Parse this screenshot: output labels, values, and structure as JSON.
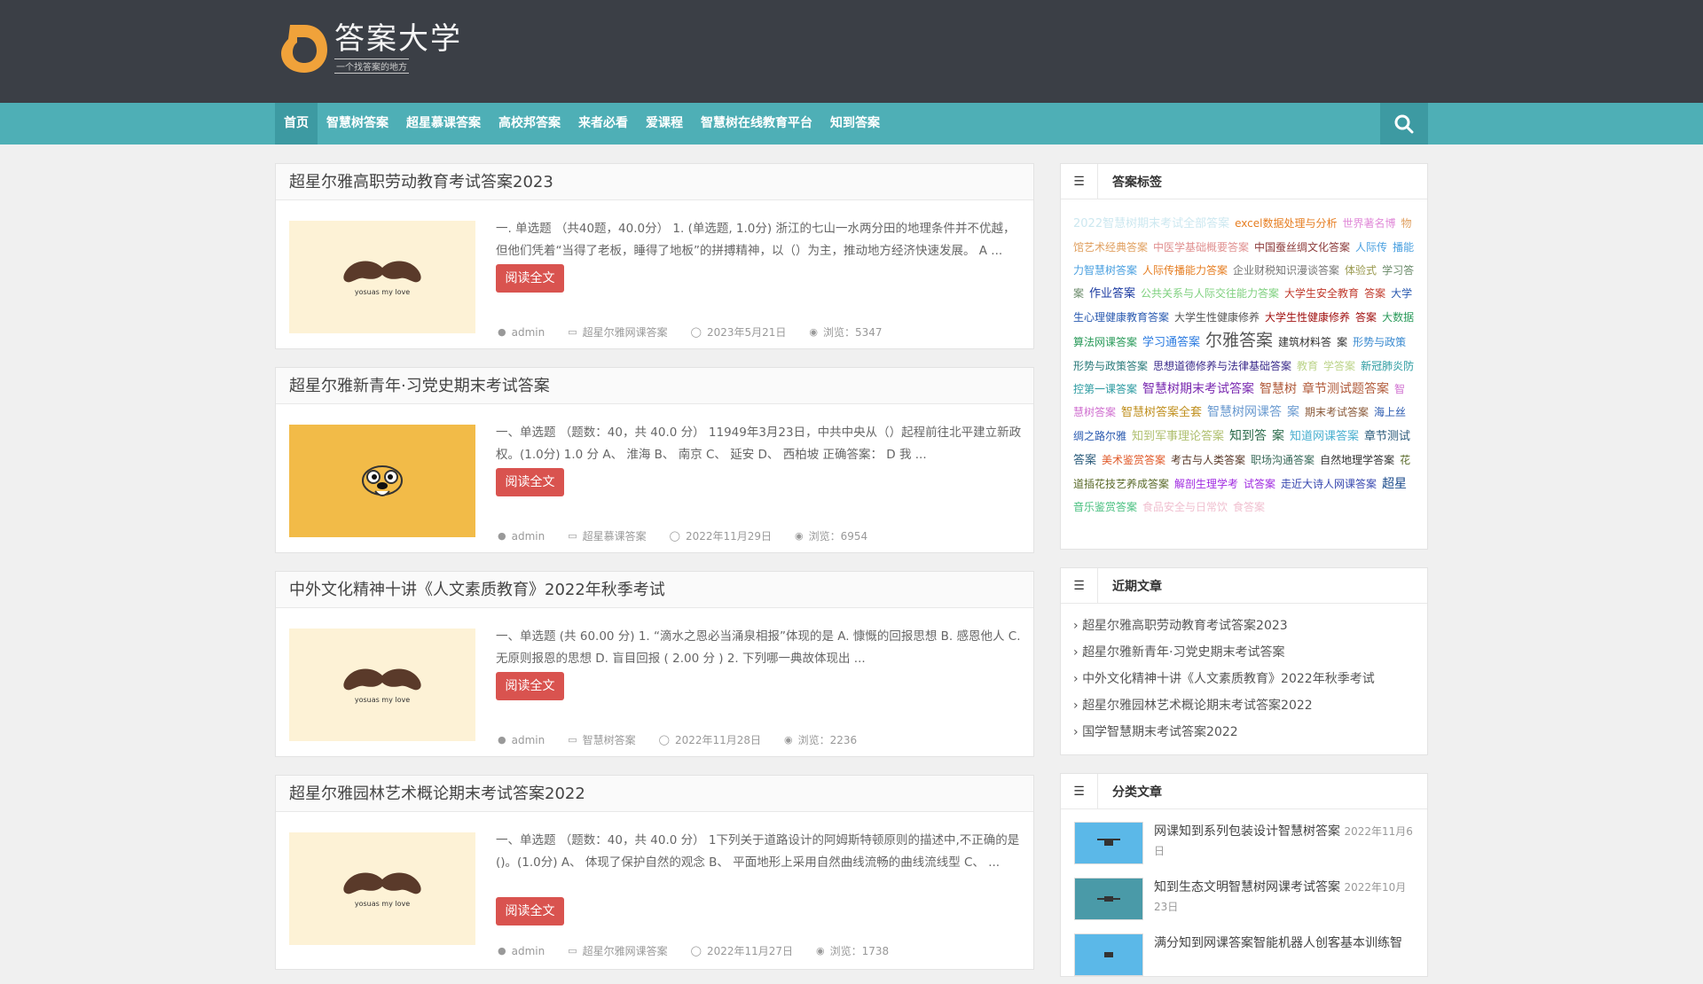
{
  "site": {
    "logo_title": "答案大学",
    "logo_sub": "一个找答案的地方"
  },
  "nav": {
    "items": [
      {
        "label": "首页"
      },
      {
        "label": "智慧树答案"
      },
      {
        "label": "超星慕课答案"
      },
      {
        "label": "高校邦答案"
      },
      {
        "label": "来者必看"
      },
      {
        "label": "爱课程"
      },
      {
        "label": "智慧树在线教育平台"
      },
      {
        "label": "知到答案"
      }
    ],
    "search_icon": "search-icon"
  },
  "articles": [
    {
      "title": "超星尔雅高职劳动教育考试答案2023",
      "excerpt": "一. 单选题 （共40题，40.0分） 1. (单选题, 1.0分) 浙江的七山一水两分田的地理条件并不优越，但他们凭着“当得了老板，睡得了地板”的拼搏精神，以（）为主，推动地方经济快速发展。 A ...",
      "read_label": "阅读全文",
      "author": "admin",
      "category": "超星尔雅网课答案",
      "date": "2023年5月21日",
      "views": "浏览：5347",
      "thumb": "mustache"
    },
    {
      "title": "超星尔雅新青年·习党史期末考试答案",
      "excerpt": "一、单选题 （题数：40，共 40.0 分） 11949年3月23日，中共中央从（）起程前往北平建立新政权。(1.0分) 1.0 分 A、 淮海 B、 南京 C、 延安 D、 西柏坡 正确答案： D 我 ...",
      "read_label": "阅读全文",
      "author": "admin",
      "category": "超星慕课答案",
      "date": "2022年11月29日",
      "views": "浏览：6954",
      "thumb": "dog"
    },
    {
      "title": "中外文化精神十讲《人文素质教育》2022年秋季考试",
      "excerpt": "一、单选题 (共 60.00 分) 1. “滴水之恩必当涌泉相报”体现的是 A. 慷慨的回报思想 B. 感恩他人 C. 无原则报恩的思想 D. 盲目回报 ( 2.00 分 ) 2. 下列哪一典故体现出 ...",
      "read_label": "阅读全文",
      "author": "admin",
      "category": "智慧树答案",
      "date": "2022年11月28日",
      "views": "浏览：2236",
      "thumb": "mustache"
    },
    {
      "title": "超星尔雅园林艺术概论期末考试答案2022",
      "excerpt": "一、单选题 （题数：40，共 40.0 分） 1下列关于道路设计的阿姆斯特顿原则的描述中,不正确的是()。(1.0分) A、 体现了保护自然的观念 B、 平面地形上采用自然曲线流畅的曲线流线型 C、 ...",
      "read_label": "阅读全文",
      "author": "admin",
      "category": "超星尔雅网课答案",
      "date": "2022年11月27日",
      "views": "浏览：1738",
      "thumb": "mustache"
    }
  ],
  "tags_widget": {
    "title": "答案标签",
    "tags": [
      {
        "text": "2022智慧树期末考试全部答案",
        "color": "#cde8f0",
        "size": 13
      },
      {
        "text": "excel数据处理与分析",
        "color": "#e67e22",
        "size": 12
      },
      {
        "text": "世界著名博",
        "color": "#e08ad8",
        "size": 12
      },
      {
        "text": "物馆艺术经典答案",
        "color": "#e0a060",
        "size": 12
      },
      {
        "text": "中医学基础概要答案",
        "color": "#e09090",
        "size": 12
      },
      {
        "text": "中国蚕丝绸文化答案",
        "color": "#8b3a3a",
        "size": 12
      },
      {
        "text": "人际传",
        "color": "#4aa0e0",
        "size": 12
      },
      {
        "text": "播能力智慧树答案",
        "color": "#4aa0e0",
        "size": 12
      },
      {
        "text": "人际传播能力答案",
        "color": "#e67e22",
        "size": 12
      },
      {
        "text": "企业财税知识漫谈答案",
        "color": "#777",
        "size": 12
      },
      {
        "text": "体验式",
        "color": "#9a9a50",
        "size": 12
      },
      {
        "text": "学习答案",
        "color": "#6a8a6a",
        "size": 12
      },
      {
        "text": "作业答案",
        "color": "#1a3aa0",
        "size": 13
      },
      {
        "text": "公共关系与人际交往能力答案",
        "color": "#7ed07e",
        "size": 12
      },
      {
        "text": "大学生安全教育",
        "color": "#c0392b",
        "size": 12
      },
      {
        "text": "答案",
        "color": "#c0392b",
        "size": 12
      },
      {
        "text": "大学生心理健康教育答案",
        "color": "#2a5ab0",
        "size": 12
      },
      {
        "text": "大学生性健康修养",
        "color": "#555",
        "size": 12
      },
      {
        "text": "大学生性健康修养",
        "color": "#a01010",
        "size": 12
      },
      {
        "text": "答案",
        "color": "#a01010",
        "size": 12
      },
      {
        "text": "大数据算法网课答案",
        "color": "#2a9a5a",
        "size": 12
      },
      {
        "text": "学习通答案",
        "color": "#2a7ae0",
        "size": 13
      },
      {
        "text": "尔雅答案",
        "color": "#555",
        "size": 19
      },
      {
        "text": "建筑材料答",
        "color": "#333",
        "size": 12
      },
      {
        "text": "案",
        "color": "#333",
        "size": 12
      },
      {
        "text": "形势与政策",
        "color": "#3a8ad0",
        "size": 12
      },
      {
        "text": "形势与政策答案",
        "color": "#2a7a7a",
        "size": 12
      },
      {
        "text": "思想道德修养与法律基础答案",
        "color": "#3a2a8a",
        "size": 12
      },
      {
        "text": "教育",
        "color": "#bcd48a",
        "size": 12
      },
      {
        "text": "学答案",
        "color": "#bcd48a",
        "size": 12
      },
      {
        "text": "新冠肺炎防控第一课答案",
        "color": "#2a9aa0",
        "size": 12
      },
      {
        "text": "智慧树期末考试答案",
        "color": "#7a2ab0",
        "size": 14
      },
      {
        "text": "智慧树",
        "color": "#b05a3a",
        "size": 14
      },
      {
        "text": "章节测试题答案",
        "color": "#b05a3a",
        "size": 14
      },
      {
        "text": "智慧树答案",
        "color": "#d070d0",
        "size": 12
      },
      {
        "text": "智慧树答案全套",
        "color": "#c09020",
        "size": 13
      },
      {
        "text": "智慧树网课答",
        "color": "#6a9ad0",
        "size": 14
      },
      {
        "text": "案",
        "color": "#6a9ad0",
        "size": 14
      },
      {
        "text": "期末考试答案",
        "color": "#8a5a3a",
        "size": 12
      },
      {
        "text": "海上丝绸之路尔雅",
        "color": "#2a5ab0",
        "size": 12
      },
      {
        "text": "知到军事理论答案",
        "color": "#b0c070",
        "size": 13
      },
      {
        "text": "知到答",
        "color": "#2a6a4a",
        "size": 14
      },
      {
        "text": "案",
        "color": "#2a6a4a",
        "size": 14
      },
      {
        "text": "知道网课答案",
        "color": "#4ab0d0",
        "size": 13
      },
      {
        "text": "章节测试答案",
        "color": "#2a5a7a",
        "size": 13
      },
      {
        "text": "美术鉴赏答案",
        "color": "#e05a2a",
        "size": 12
      },
      {
        "text": "考古与人类答案",
        "color": "#5a3a2a",
        "size": 12
      },
      {
        "text": "职场沟通答案",
        "color": "#3a6a5a",
        "size": 12
      },
      {
        "text": "自然地理学答案",
        "color": "#333",
        "size": 12
      },
      {
        "text": "花道插花技艺养成答案",
        "color": "#5a6a2a",
        "size": 12
      },
      {
        "text": "解剖生理学考",
        "color": "#a02ae0",
        "size": 12
      },
      {
        "text": "试答案",
        "color": "#a02ae0",
        "size": 12
      },
      {
        "text": "走近大诗人网课答案",
        "color": "#3a4ab0",
        "size": 12
      },
      {
        "text": "超星",
        "color": "#1a4a8a",
        "size": 14
      },
      {
        "text": "音乐鉴赏答案",
        "color": "#4ac080",
        "size": 12
      },
      {
        "text": "食品安全与日常饮",
        "color": "#f0c0d0",
        "size": 12
      },
      {
        "text": "食答案",
        "color": "#f0c0d0",
        "size": 12
      }
    ]
  },
  "recent_widget": {
    "title": "近期文章",
    "items": [
      "超星尔雅高职劳动教育考试答案2023",
      "超星尔雅新青年·习党史期末考试答案",
      "中外文化精神十讲《人文素质教育》2022年秋季考试",
      "超星尔雅园林艺术概论期末考试答案2022",
      "国学智慧期末考试答案2022"
    ]
  },
  "category_widget": {
    "title": "分类文章",
    "items": [
      {
        "title": "网课知到系列包装设计智慧树答案",
        "date": "2022年11月6日"
      },
      {
        "title": "知到生态文明智慧树网课考试答案",
        "date": "2022年10月23日"
      },
      {
        "title": "满分知到网课答案智能机器人创客基本训练智",
        "date": ""
      }
    ]
  },
  "colors": {
    "topbar": "#3b3f46",
    "navbar": "#4eafb6",
    "nav_active": "#3d9aa2",
    "read_button": "#d9534f",
    "logo_orange": "#f0a23a"
  }
}
